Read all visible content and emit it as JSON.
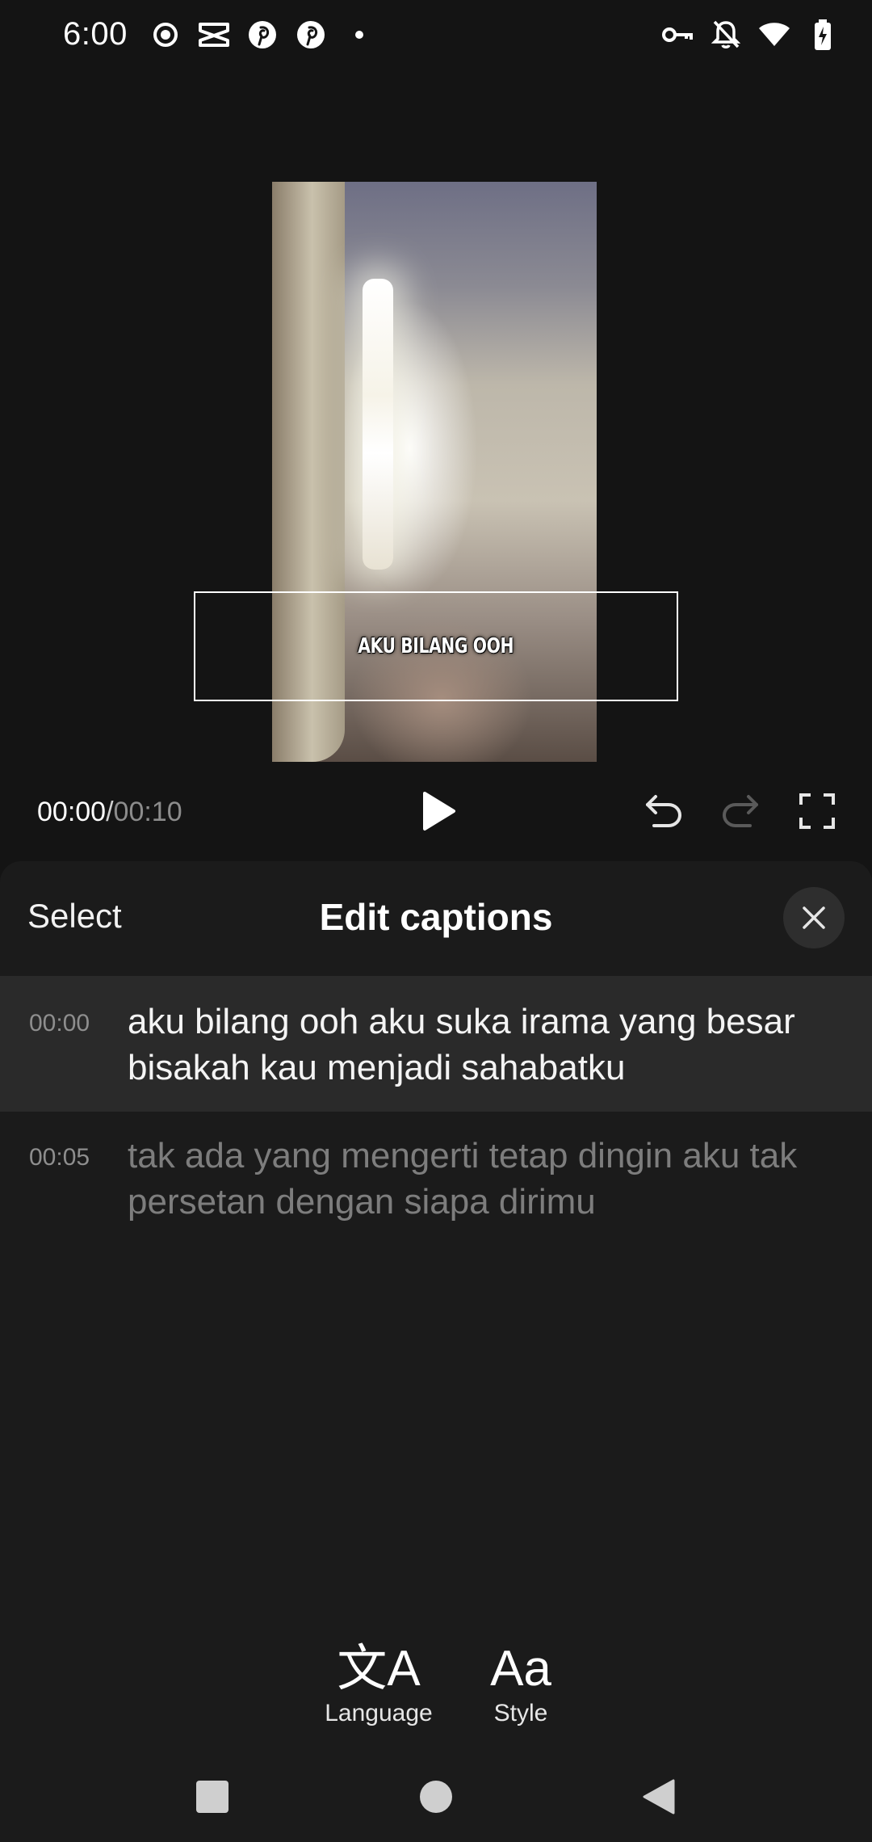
{
  "status_bar": {
    "time": "6:00",
    "left_icons": [
      "record-icon",
      "capcut-icon",
      "pinterest-icon",
      "pinterest-icon",
      "dot-icon"
    ],
    "right_icons": [
      "vpn-key-icon",
      "bell-off-icon",
      "wifi-icon",
      "battery-charging-icon"
    ]
  },
  "preview": {
    "caption_overlay": "AKU BILANG OOH"
  },
  "player": {
    "current_time": "00:00",
    "separator": "/",
    "total_time": "00:10"
  },
  "sheet": {
    "select_label": "Select",
    "title": "Edit captions"
  },
  "captions": [
    {
      "time": "00:00",
      "text": "aku bilang ooh aku suka irama yang besar bisakah kau menjadi sahabatku"
    },
    {
      "time": "00:05",
      "text": "tak ada yang mengerti tetap dingin aku tak persetan dengan siapa dirimu"
    }
  ],
  "tools": {
    "language_glyph": "文A",
    "language_label": "Language",
    "style_glyph": "Aa",
    "style_label": "Style"
  },
  "colors": {
    "background": "#141414",
    "sheet": "#1b1b1b",
    "active_row": "#2a2a2a"
  }
}
